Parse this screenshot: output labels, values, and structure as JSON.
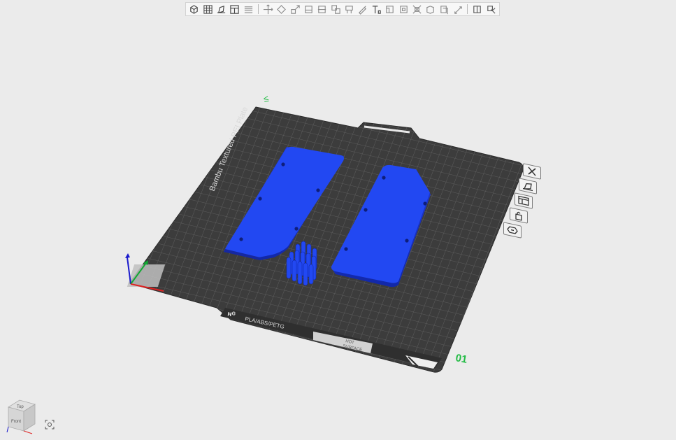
{
  "toolbar": {
    "items": [
      {
        "icon": "add-box-icon"
      },
      {
        "icon": "grid-arrange-icon"
      },
      {
        "icon": "orient-icon"
      },
      {
        "icon": "layout-icon"
      },
      {
        "icon": "layers-icon"
      },
      {
        "icon": "move-icon"
      },
      {
        "icon": "rotate-icon"
      },
      {
        "icon": "scale-icon"
      },
      {
        "icon": "lay-on-face-icon"
      },
      {
        "icon": "cut-icon"
      },
      {
        "icon": "split-objects-icon"
      },
      {
        "icon": "support-paint-icon"
      },
      {
        "icon": "seam-paint-icon"
      },
      {
        "icon": "text-shape-icon"
      },
      {
        "icon": "measure-icon"
      },
      {
        "icon": "boolean-icon"
      },
      {
        "icon": "mesh-repair-icon"
      },
      {
        "icon": "variable-layer-icon"
      },
      {
        "icon": "color-paint-icon"
      },
      {
        "icon": "assemble-icon"
      },
      {
        "icon": "brim-ears-icon"
      },
      {
        "icon": "view-settings-icon"
      }
    ]
  },
  "bed": {
    "plate_label": "Bambu Textured PEI Plate",
    "filament_label": "PLA/ABS/PETG",
    "logo_label": "ʜᴳ",
    "hot_surface_line1": "HOT",
    "hot_surface_line2": "SURFACE",
    "plate_number": "01",
    "corner_mark": "≤"
  },
  "plate_side_buttons": [
    {
      "icon": "close-icon"
    },
    {
      "icon": "auto-orient-icon"
    },
    {
      "icon": "arrange-icon"
    },
    {
      "icon": "lock-icon"
    },
    {
      "icon": "plate-settings-icon"
    }
  ],
  "nav_cube": {
    "top_label": "Top",
    "front_label": "Front"
  },
  "colors": {
    "background": "#ebebeb",
    "bed": "#3b3b3b",
    "grid_line": "#6b6b6b",
    "model": "#2040ee",
    "plate_number": "#22bb44"
  }
}
